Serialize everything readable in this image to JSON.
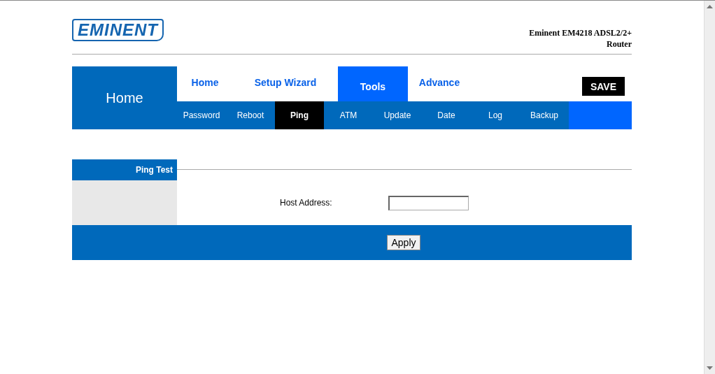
{
  "logo": "EMINENT",
  "product_title": "Eminent EM4218 ADSL2/2+ Router",
  "section_title": "Home",
  "main_tabs": [
    {
      "label": "Home",
      "selected": false
    },
    {
      "label": "Setup Wizard",
      "selected": false
    },
    {
      "label": "Tools",
      "selected": true
    },
    {
      "label": "Advance",
      "selected": false
    }
  ],
  "save_button": "SAVE",
  "sub_tabs": [
    {
      "label": "Password",
      "selected": false
    },
    {
      "label": "Reboot",
      "selected": false
    },
    {
      "label": "Ping",
      "selected": true
    },
    {
      "label": "ATM",
      "selected": false
    },
    {
      "label": "Update",
      "selected": false
    },
    {
      "label": "Date",
      "selected": false
    },
    {
      "label": "Log",
      "selected": false
    },
    {
      "label": "Backup",
      "selected": false
    }
  ],
  "panel": {
    "title": "Ping Test",
    "fields": [
      {
        "label": "Host Address:"
      }
    ],
    "apply_button": "Apply"
  }
}
